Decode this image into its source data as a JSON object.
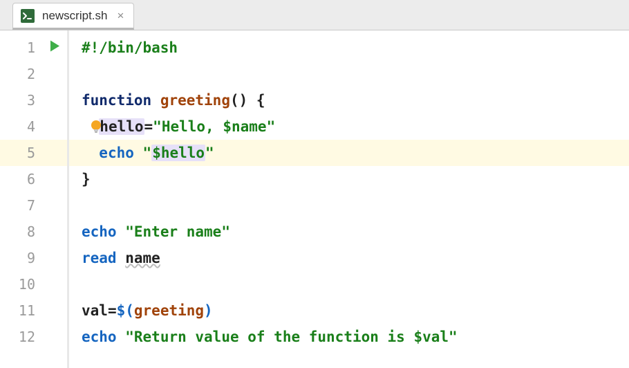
{
  "tab": {
    "filename": "newscript.sh",
    "close_glyph": "×"
  },
  "icons": {
    "file": "shell-file-icon",
    "run": "run-icon",
    "bulb": "intention-bulb-icon"
  },
  "editor": {
    "current_line": 5,
    "run_marker_line": 1,
    "bulb_line": 4,
    "gutter_numbers": [
      "1",
      "2",
      "3",
      "4",
      "5",
      "6",
      "7",
      "8",
      "9",
      "10",
      "11",
      "12"
    ],
    "lines": {
      "l1": {
        "shebang": "#!/bin/bash"
      },
      "l3": {
        "kw_function": "function",
        "sp": " ",
        "fn_name": "greeting",
        "tail": "() {"
      },
      "l4": {
        "indent": "  ",
        "lhs": "hello",
        "eq": "=",
        "str_open": "\"",
        "str_lit": "Hello, ",
        "var": "$name",
        "str_close": "\""
      },
      "l5": {
        "indent": "  ",
        "echo": "echo",
        "sp": " ",
        "str_open": "\"",
        "var": "$hello",
        "str_close": "\""
      },
      "l6": {
        "brace": "}"
      },
      "l8": {
        "echo": "echo",
        "sp": " ",
        "str_open": "\"",
        "text": "Enter name",
        "str_close": "\""
      },
      "l9": {
        "read": "read",
        "sp": " ",
        "arg": "name"
      },
      "l11": {
        "lhs": "val",
        "eq": "=",
        "dollar": "$(",
        "call": "greeting",
        "close": ")"
      },
      "l12": {
        "echo": "echo",
        "sp": " ",
        "str_open": "\"",
        "text": "Return value of the function is ",
        "var": "$val",
        "str_close": "\""
      }
    }
  }
}
